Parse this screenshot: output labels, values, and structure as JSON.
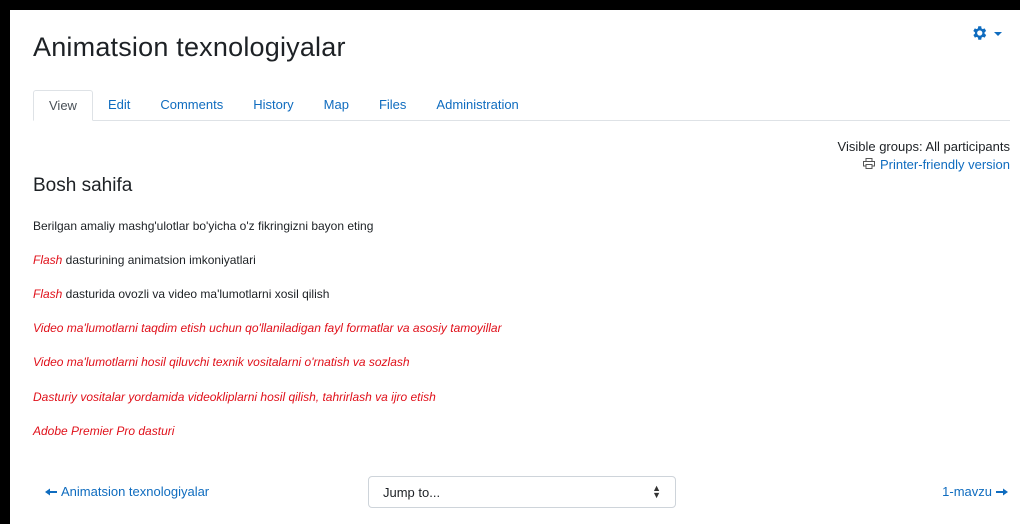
{
  "page": {
    "title": "Animatsion texnologiyalar"
  },
  "tabs": [
    {
      "label": "View"
    },
    {
      "label": "Edit"
    },
    {
      "label": "Comments"
    },
    {
      "label": "History"
    },
    {
      "label": "Map"
    },
    {
      "label": "Files"
    },
    {
      "label": "Administration"
    }
  ],
  "groups": {
    "label": "Visible groups: All participants"
  },
  "printer": {
    "label": "Printer-friendly version"
  },
  "content": {
    "heading": "Bosh sahifa",
    "intro": "Berilgan amaliy mashg'ulotlar bo'yicha o'z fikringizni bayon eting",
    "line1_link": "Flash",
    "line1_rest": " dasturining animatsion imkoniyatlari",
    "line2_link": "Flash",
    "line2_rest": " dasturida ovozli va video ma'lumotlarni xosil qilish",
    "links": [
      "Video ma'lumotlarni taqdim etish uchun qo'llaniladigan fayl formatlar va asosiy tamoyillar",
      "Video ma'lumotlarni hosil qiluvchi texnik vositalarni o'rnatish va sozlash",
      "Dasturiy vositalar yordamida videokliplarni hosil qilish, tahrirlash va ijro etish",
      "Adobe Premier Pro dasturi"
    ]
  },
  "footer": {
    "prev_label": "Animatsion texnologiyalar",
    "jump_placeholder": "Jump to...",
    "next_label": "1-mavzu"
  },
  "colors": {
    "link": "#0f6cbf",
    "missing_page": "#e0101a"
  },
  "icons": {
    "settings": "gear-icon",
    "printer": "printer-icon",
    "prev": "arrow-left-icon",
    "next": "arrow-right-icon"
  }
}
